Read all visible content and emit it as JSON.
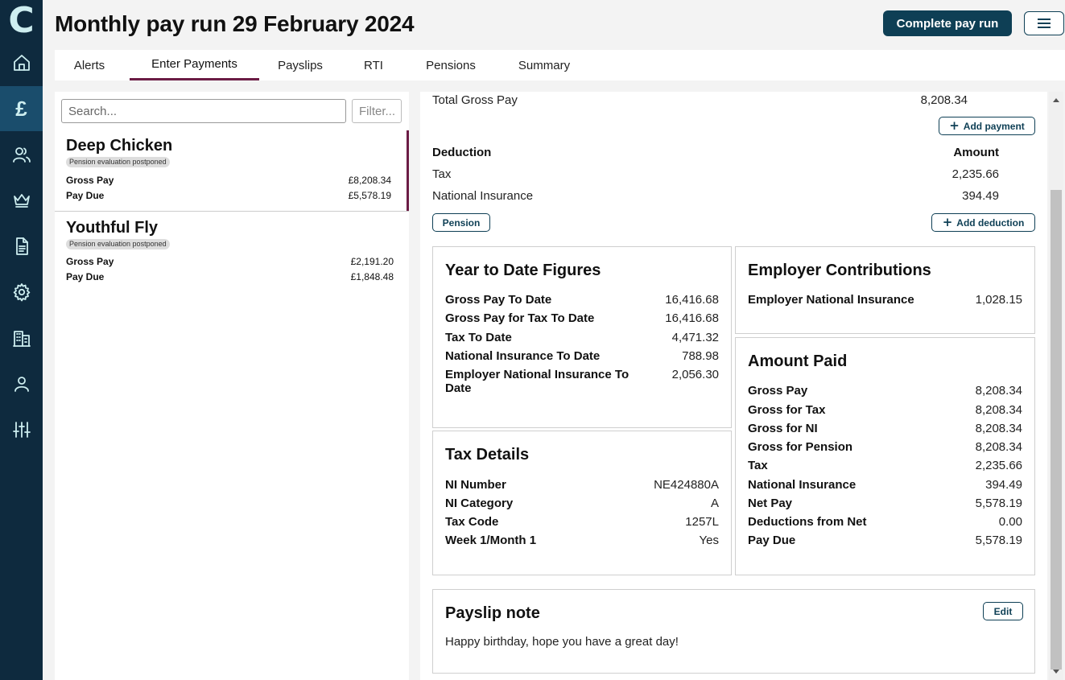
{
  "nav": {
    "logo": "C",
    "items": [
      {
        "icon": "home-icon"
      },
      {
        "icon": "pound-icon",
        "glyph": "£"
      },
      {
        "icon": "people-icon"
      },
      {
        "icon": "crown-icon"
      },
      {
        "icon": "document-icon"
      },
      {
        "icon": "gear-icon"
      },
      {
        "icon": "building-icon"
      },
      {
        "icon": "user-icon"
      },
      {
        "icon": "sliders-icon"
      }
    ]
  },
  "header": {
    "title": "Monthly pay run 29 February 2024",
    "complete_label": "Complete pay run"
  },
  "tabs": [
    "Alerts",
    "Enter Payments",
    "Payslips",
    "RTI",
    "Pensions",
    "Summary"
  ],
  "list": {
    "search_placeholder": "Search...",
    "filter_placeholder": "Filter...",
    "employees": [
      {
        "name": "Deep Chicken",
        "badge": "Pension evaluation postponed",
        "gross_label": "Gross Pay",
        "gross": "£8,208.34",
        "due_label": "Pay Due",
        "due": "£5,578.19"
      },
      {
        "name": "Youthful Fly",
        "badge": "Pension evaluation postponed",
        "gross_label": "Gross Pay",
        "gross": "£2,191.20",
        "due_label": "Pay Due",
        "due": "£1,848.48"
      }
    ]
  },
  "payments": {
    "total_label": "Total Gross Pay",
    "total_value": "8,208.34",
    "add_payment": "Add payment"
  },
  "deductions": {
    "header_label": "Deduction",
    "header_amount": "Amount",
    "rows": [
      {
        "label": "Tax",
        "value": "2,235.66"
      },
      {
        "label": "National Insurance",
        "value": "394.49"
      }
    ],
    "pension_label": "Pension",
    "add_deduction": "Add deduction"
  },
  "ytd": {
    "title": "Year to Date Figures",
    "rows": [
      {
        "label": "Gross Pay To Date",
        "value": "16,416.68"
      },
      {
        "label": "Gross Pay for Tax To Date",
        "value": "16,416.68"
      },
      {
        "label": "Tax To Date",
        "value": "4,471.32"
      },
      {
        "label": "National Insurance To Date",
        "value": "788.98"
      },
      {
        "label_line1": "Employer National Insurance To",
        "label_line2": "Date",
        "value": "2,056.30"
      }
    ]
  },
  "employer": {
    "title": "Employer Contributions",
    "rows": [
      {
        "label": "Employer National Insurance",
        "value": "1,028.15"
      }
    ]
  },
  "tax": {
    "title": "Tax Details",
    "rows": [
      {
        "label": "NI Number",
        "value": "NE424880A"
      },
      {
        "label": "NI Category",
        "value": "A"
      },
      {
        "label": "Tax Code",
        "value": "1257L"
      },
      {
        "label": "Week 1/Month 1",
        "value": "Yes"
      }
    ]
  },
  "amount_paid": {
    "title": "Amount Paid",
    "rows": [
      {
        "label": "Gross Pay",
        "value": "8,208.34"
      },
      {
        "label": "Gross for Tax",
        "value": "8,208.34"
      },
      {
        "label": "Gross for NI",
        "value": "8,208.34"
      },
      {
        "label": "Gross for Pension",
        "value": "8,208.34"
      },
      {
        "label": "Tax",
        "value": "2,235.66"
      },
      {
        "label": "National Insurance",
        "value": "394.49"
      },
      {
        "label": "Net Pay",
        "value": "5,578.19"
      },
      {
        "label": "Deductions from Net",
        "value": "0.00"
      },
      {
        "label": "Pay Due",
        "value": "5,578.19"
      }
    ]
  },
  "payslip_note": {
    "title": "Payslip note",
    "edit_label": "Edit",
    "text": "Happy birthday, hope you have a great day!"
  }
}
